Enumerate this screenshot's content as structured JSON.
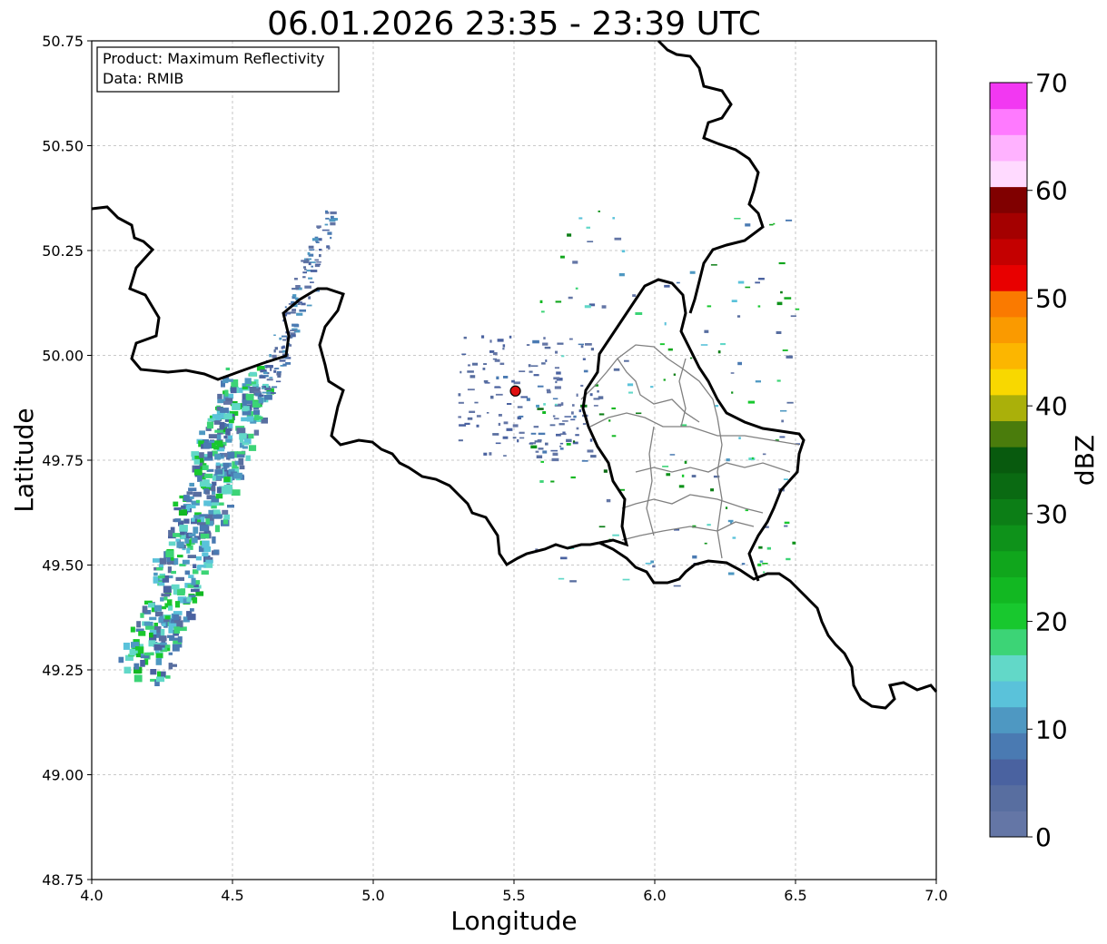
{
  "title": "06.01.2026 23:35 - 23:39 UTC",
  "info_box": {
    "line1": "Product: Maximum Reflectivity",
    "line2": "Data: RMIB"
  },
  "axes": {
    "xlabel": "Longitude",
    "ylabel": "Latitude",
    "xlim": [
      4.0,
      7.0
    ],
    "ylim": [
      48.75,
      50.75
    ],
    "xticks": [
      "4.0",
      "4.5",
      "5.0",
      "5.5",
      "6.0",
      "6.5",
      "7.0"
    ],
    "yticks": [
      "48.75",
      "49.00",
      "49.25",
      "49.50",
      "49.75",
      "50.00",
      "50.25",
      "50.50",
      "50.75"
    ],
    "grid": true
  },
  "colorbar": {
    "label": "dBZ",
    "range": [
      0,
      70
    ],
    "ticks": [
      "0",
      "10",
      "20",
      "30",
      "40",
      "50",
      "60",
      "70"
    ],
    "colors": [
      "#6476a6",
      "#586ea0",
      "#4a62a0",
      "#4a7ab2",
      "#4e98c2",
      "#5ac2da",
      "#62d8c8",
      "#3cd476",
      "#18c82e",
      "#12b822",
      "#10a61c",
      "#0e921a",
      "#0c7e16",
      "#0a6a12",
      "#085a0e",
      "#4a7c0c",
      "#aab00a",
      "#f8d800",
      "#fcb600",
      "#fa9a00",
      "#fa7a00",
      "#e80000",
      "#c40000",
      "#a40000",
      "#800000",
      "#ffdaff",
      "#ffb2ff",
      "#ff7aff",
      "#f238f2"
    ]
  },
  "radar_marker": {
    "lon": 5.505,
    "lat": 49.915,
    "color": "#e01010"
  },
  "chart_data": {
    "type": "heatmap",
    "title": "06.01.2026 23:35 - 23:39 UTC",
    "xlabel": "Longitude",
    "ylabel": "Latitude",
    "xlim": [
      4.0,
      7.0
    ],
    "ylim": [
      48.75,
      50.75
    ],
    "value_label": "dBZ",
    "value_range": [
      0,
      70
    ],
    "echo_areas": [
      {
        "lon": [
          4.05,
          4.55
        ],
        "lat": [
          49.25,
          49.95
        ],
        "max_dbz": 22
      },
      {
        "lon": [
          4.6,
          4.85
        ],
        "lat": [
          49.9,
          50.35
        ],
        "max_dbz": 15
      },
      {
        "lon": [
          5.3,
          5.8
        ],
        "lat": [
          49.75,
          50.05
        ],
        "max_dbz": 10
      },
      {
        "lon": [
          5.55,
          6.5
        ],
        "lat": [
          49.45,
          50.35
        ],
        "max_dbz": 40
      }
    ]
  }
}
